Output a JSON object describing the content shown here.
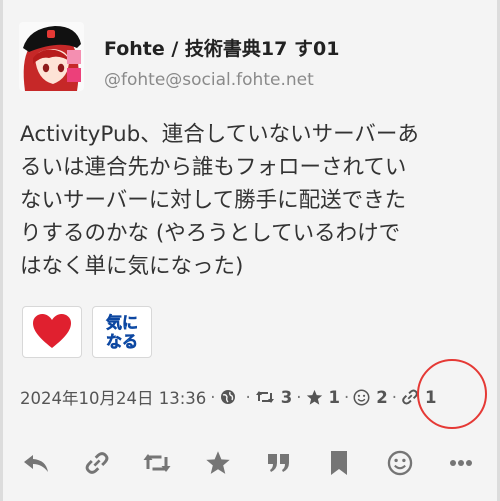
{
  "post": {
    "display_name": "Fohte / 技術書典17 す01",
    "handle": "@fohte@social.fohte.net",
    "content_lines": [
      "ActivityPub、連合していないサーバーあ",
      "るいは連合先から誰もフォローされてい",
      "ないサーバーに対して勝手に配送できた",
      "りするのかな (やろうとしているわけで",
      "はなく単に気になった)"
    ]
  },
  "reactions": [
    {
      "name": "heart",
      "text": "",
      "color": "#e0202f"
    },
    {
      "name": "kininaru",
      "text_line1": "気に",
      "text_line2": "なる",
      "color": "#2196f3"
    }
  ],
  "meta": {
    "timestamp": "2024年10月24日 13:36",
    "visibility_icon": "globe-icon",
    "boosts": "3",
    "favourites": "1",
    "emoji_reactions": "2",
    "quotes": "1"
  },
  "actions": [
    {
      "name": "reply",
      "icon": "reply-icon"
    },
    {
      "name": "copy-link",
      "icon": "link-icon"
    },
    {
      "name": "boost",
      "icon": "boost-icon"
    },
    {
      "name": "favourite",
      "icon": "star-icon"
    },
    {
      "name": "quote",
      "icon": "quote-icon"
    },
    {
      "name": "bookmark",
      "icon": "bookmark-icon"
    },
    {
      "name": "react",
      "icon": "smile-icon"
    },
    {
      "name": "more",
      "icon": "more-icon"
    }
  ],
  "colors": {
    "accent_circle": "#e53935",
    "icon_gray": "#757575",
    "heart": "#e0202f"
  }
}
